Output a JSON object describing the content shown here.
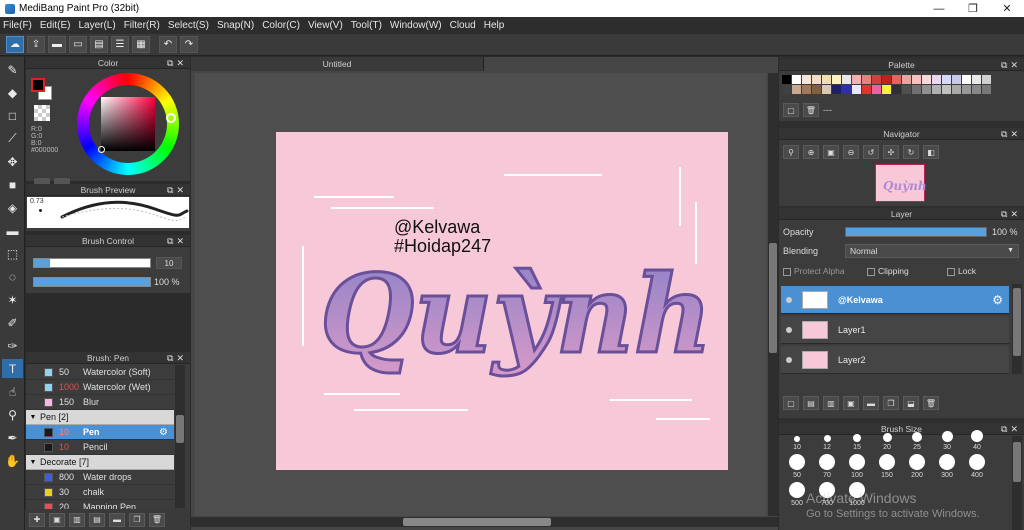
{
  "window": {
    "title": "MediBang Paint Pro (32bit)",
    "minimize": "—",
    "maximize": "❐",
    "close": "✕"
  },
  "menu": [
    "File(F)",
    "Edit(E)",
    "Layer(L)",
    "Filter(R)",
    "Select(S)",
    "Snap(N)",
    "Color(C)",
    "View(V)",
    "Tool(T)",
    "Window(W)",
    "Cloud",
    "Help"
  ],
  "panels": {
    "color": {
      "title": "Color",
      "r": "R:0",
      "g": "G:0",
      "b": "B:0",
      "hex": "#000000"
    },
    "brush_preview": {
      "title": "Brush Preview",
      "size": "0.73"
    },
    "brush_control": {
      "title": "Brush Control",
      "size_value": "10",
      "opacity_value": "100 %",
      "size_fraction": 0.14,
      "opacity_fraction": 1.0
    },
    "brush_list": {
      "title": "Brush: Pen",
      "rows": [
        {
          "type": "item",
          "swatch": "#8fd3f4",
          "num": "50",
          "name": "Watercolor (Soft)",
          "red": false
        },
        {
          "type": "item",
          "swatch": "#8fd3f4",
          "num": "1000",
          "name": "Watercolor (Wet)",
          "red": true
        },
        {
          "type": "item",
          "swatch": "#f7b6e0",
          "num": "150",
          "name": "Blur",
          "red": false
        },
        {
          "type": "group",
          "name": "Pen [2]"
        },
        {
          "type": "item",
          "swatch": "#1a1a1a",
          "num": "10",
          "name": "Pen",
          "red": true,
          "selected": true
        },
        {
          "type": "item",
          "swatch": "#1a1a1a",
          "num": "10",
          "name": "Pencil",
          "red": true
        },
        {
          "type": "group",
          "name": "Decorate [7]"
        },
        {
          "type": "item",
          "swatch": "#3c5ee0",
          "num": "800",
          "name": "Water drops",
          "red": false
        },
        {
          "type": "item",
          "swatch": "#e8d020",
          "num": "30",
          "name": "chalk",
          "red": false
        },
        {
          "type": "item",
          "swatch": "#e85050",
          "num": "20",
          "name": "Mapping Pen",
          "red": false
        }
      ]
    },
    "palette": {
      "title": "Palette",
      "status": "---"
    },
    "navigator": {
      "title": "Navigator"
    },
    "layer": {
      "title": "Layer",
      "opacity_label": "Opacity",
      "opacity_value": "100 %",
      "blending_label": "Blending",
      "blending_value": "Normal",
      "protect_alpha": "Protect Alpha",
      "clipping": "Clipping",
      "lock": "Lock",
      "layers": [
        {
          "name": "@Kelvawa",
          "selected": true
        },
        {
          "name": "Layer1",
          "selected": false
        },
        {
          "name": "Layer2",
          "selected": false
        }
      ]
    },
    "brush_size": {
      "title": "Brush Size",
      "sizes": [
        "10",
        "12",
        "15",
        "20",
        "25",
        "30",
        "40",
        "50",
        "70",
        "100",
        "150",
        "200",
        "300",
        "400",
        "500",
        "700",
        "1000"
      ]
    }
  },
  "document": {
    "tab": "Untitled",
    "handle": "@Kelvawa",
    "hashtag": "#Hoidap247",
    "lettering": "Quỳnh"
  },
  "watermark": {
    "line1": "Activate Windows",
    "line2": "Go to Settings to activate Windows."
  },
  "colors": {
    "accent": "#4a90d2",
    "canvas_pink": "#f7c9d8",
    "palette": [
      "#000000",
      "#ffffff",
      "#f5e6d8",
      "#f2dcc4",
      "#f0e0b0",
      "#fff0c0",
      "#e8e8e8",
      "#f2b0b0",
      "#e88080",
      "#d04040",
      "#c02020",
      "#e86060",
      "#f0a0a0",
      "#f4c0c0",
      "#f8d8d8",
      "#e8d8f0",
      "#d8d8f8",
      "#c8c8e8",
      "#ffffff",
      "#e8e8e8",
      "#d0d0d0",
      "#404040",
      "#c8a890",
      "#a07860",
      "#806040",
      "#d8c8b0",
      "#202060",
      "#3030a0",
      "#e8e8f8",
      "#e83030",
      "#f060a0",
      "#f8f040",
      "#303030",
      "#505050",
      "#707070",
      "#909090",
      "#b0b0b0",
      "#c0c0c0",
      "#a8a8a8",
      "#989898",
      "#888888",
      "#787878"
    ]
  }
}
